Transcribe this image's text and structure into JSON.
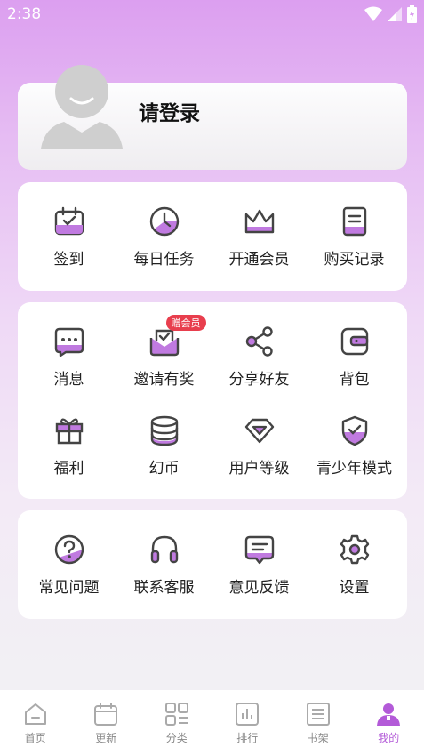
{
  "status": {
    "time": "2:38"
  },
  "profile": {
    "login_label": "请登录"
  },
  "section1": {
    "items": [
      {
        "label": "签到",
        "icon": "calendar-check-icon"
      },
      {
        "label": "每日任务",
        "icon": "clock-icon"
      },
      {
        "label": "开通会员",
        "icon": "crown-icon"
      },
      {
        "label": "购买记录",
        "icon": "document-icon"
      }
    ]
  },
  "section2": {
    "items": [
      {
        "label": "消息",
        "icon": "chat-bubble-icon"
      },
      {
        "label": "邀请有奖",
        "icon": "mail-invite-icon",
        "badge": "赠会员"
      },
      {
        "label": "分享好友",
        "icon": "share-icon"
      },
      {
        "label": "背包",
        "icon": "wallet-icon"
      },
      {
        "label": "福利",
        "icon": "gift-icon"
      },
      {
        "label": "幻币",
        "icon": "coins-icon"
      },
      {
        "label": "用户等级",
        "icon": "diamond-icon"
      },
      {
        "label": "青少年模式",
        "icon": "shield-check-icon"
      }
    ]
  },
  "section3": {
    "items": [
      {
        "label": "常见问题",
        "icon": "question-icon"
      },
      {
        "label": "联系客服",
        "icon": "headphones-icon"
      },
      {
        "label": "意见反馈",
        "icon": "feedback-icon"
      },
      {
        "label": "设置",
        "icon": "gear-icon"
      }
    ]
  },
  "tabbar": {
    "items": [
      {
        "label": "首页",
        "icon": "home-icon"
      },
      {
        "label": "更新",
        "icon": "calendar-icon"
      },
      {
        "label": "分类",
        "icon": "category-icon"
      },
      {
        "label": "排行",
        "icon": "ranking-icon"
      },
      {
        "label": "书架",
        "icon": "bookshelf-icon"
      },
      {
        "label": "我的",
        "icon": "user-icon",
        "active": true
      }
    ]
  },
  "colors": {
    "accent": "#b35ad8",
    "icon_fill": "#c07ae0",
    "icon_stroke": "#444444",
    "badge": "#e83e4d"
  }
}
